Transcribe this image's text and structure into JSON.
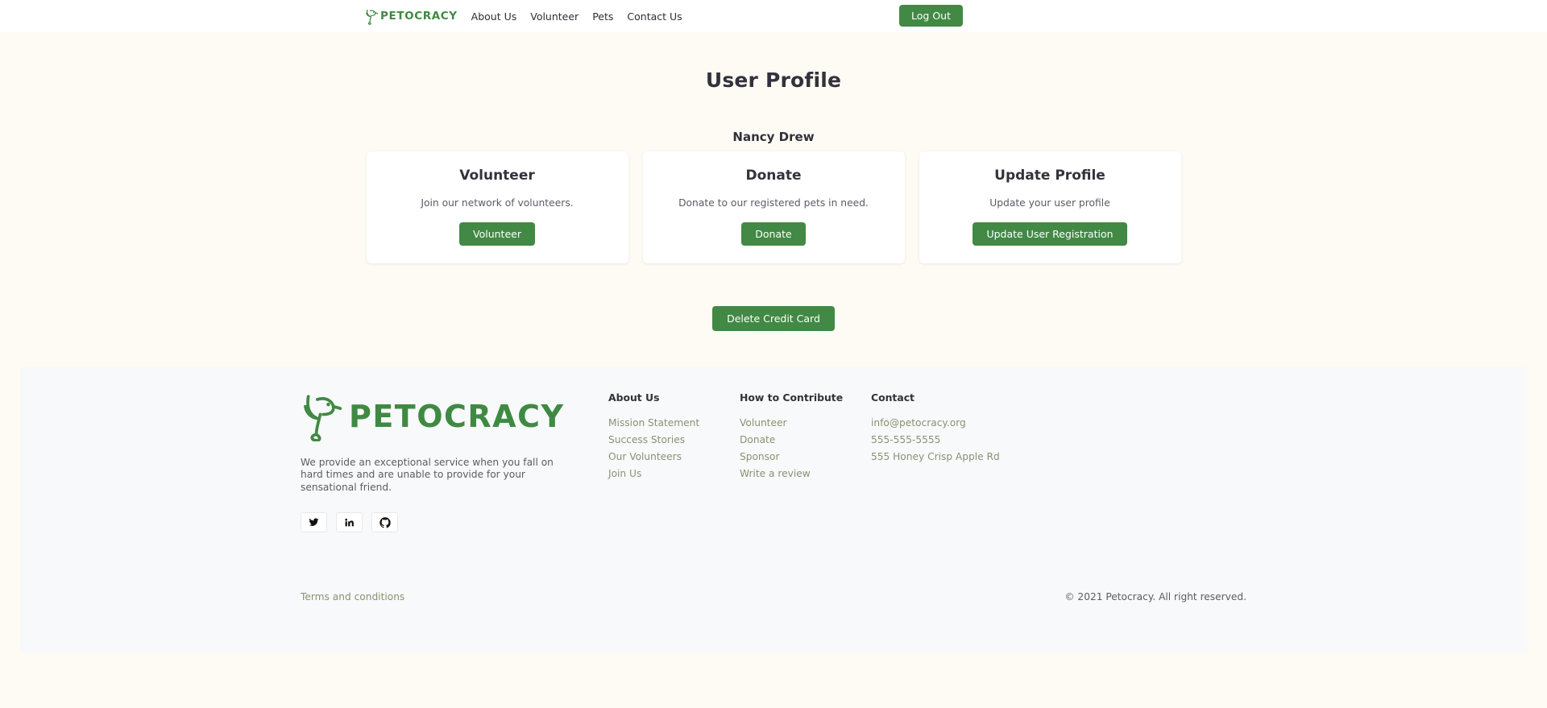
{
  "header": {
    "brand_name": "PETOCRACY",
    "brand_icon": "bird-logo-icon",
    "nav": [
      {
        "label": "About Us"
      },
      {
        "label": "Volunteer"
      },
      {
        "label": "Pets"
      },
      {
        "label": "Contact Us"
      }
    ],
    "logout_label": "Log Out",
    "accent_color": "#418944",
    "brand_color": "#3f8a43"
  },
  "main": {
    "page_title": "User Profile",
    "user_name": "Nancy Drew",
    "cards": [
      {
        "title": "Volunteer",
        "description": "Join our network of volunteers.",
        "button_label": "Volunteer"
      },
      {
        "title": "Donate",
        "description": "Donate to our registered pets in need.",
        "button_label": "Donate"
      },
      {
        "title": "Update Profile",
        "description": "Update your user profile",
        "button_label": "Update User Registration"
      }
    ],
    "delete_button_label": "Delete Credit Card"
  },
  "footer": {
    "brand_name": "PETOCRACY",
    "brand_icon": "bird-logo-icon",
    "description": "We provide an exceptional service when you fall on hard times and are unable to provide for your sensational friend.",
    "socials": [
      {
        "name": "twitter-icon"
      },
      {
        "name": "linkedin-icon"
      },
      {
        "name": "github-icon"
      }
    ],
    "columns": [
      {
        "title": "About Us",
        "items": [
          {
            "label": "Mission Statement"
          },
          {
            "label": "Success Stories"
          },
          {
            "label": "Our Volunteers"
          },
          {
            "label": "Join Us"
          }
        ]
      },
      {
        "title": "How to Contribute",
        "items": [
          {
            "label": "Volunteer"
          },
          {
            "label": "Donate"
          },
          {
            "label": "Sponsor"
          },
          {
            "label": "Write a review"
          }
        ]
      },
      {
        "title": "Contact",
        "items": [
          {
            "label": "info@petocracy.org"
          },
          {
            "label": "555-555-5555"
          },
          {
            "label": "555 Honey Crisp Apple Rd"
          }
        ]
      }
    ],
    "terms_label": "Terms and conditions",
    "copyright": "© 2021 Petocracy. All right reserved."
  }
}
